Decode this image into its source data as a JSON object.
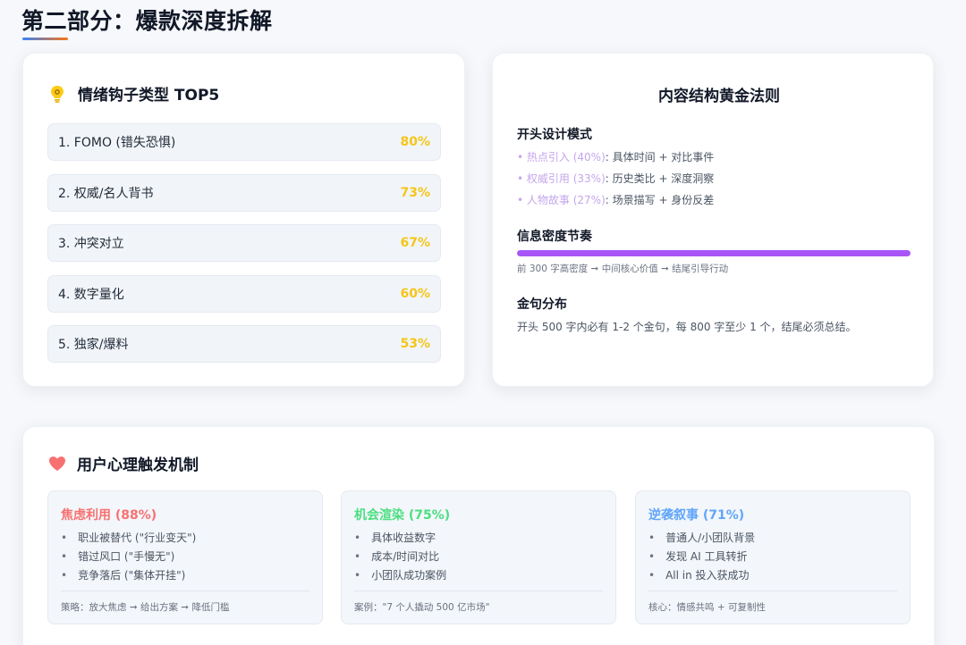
{
  "header": {
    "title": "第二部分：爆款深度拆解"
  },
  "hooks": {
    "title": "情绪钩子类型 TOP5",
    "accent": "#f5c518",
    "items": [
      {
        "label": "1. FOMO (错失恐惧)",
        "pct": "80%"
      },
      {
        "label": "2. 权威/名人背书",
        "pct": "73%"
      },
      {
        "label": "3. 冲突对立",
        "pct": "67%"
      },
      {
        "label": "4. 数字量化",
        "pct": "60%"
      },
      {
        "label": "5. 独家/爆料",
        "pct": "53%"
      }
    ]
  },
  "rules": {
    "title": "内容结构黄金法则",
    "opening": {
      "title": "开头设计模式",
      "items": [
        {
          "bullet": "•",
          "key": "热点引入 (40%)",
          "desc": ": 具体时间 + 对比事件"
        },
        {
          "bullet": "•",
          "key": "权威引用 (33%)",
          "desc": ": 历史类比 + 深度洞察"
        },
        {
          "bullet": "•",
          "key": "人物故事 (27%)",
          "desc": ": 场景描写 + 身份反差"
        }
      ]
    },
    "density": {
      "title": "信息密度节奏",
      "fill_fraction": 1.0,
      "note": "前 300 字高密度 ➞ 中间核心价值 ➞ 结尾引导行动"
    },
    "quotes": {
      "title": "金句分布",
      "text": "开头 500 字内必有 1-2 个金句，每 800 字至少 1 个，结尾必须总结。"
    }
  },
  "psych": {
    "title": "用户心理触发机制",
    "boxes": [
      {
        "title": "焦虑利用 (88%)",
        "color": "#f87171",
        "items": [
          "职业被替代 (\"行业变天\")",
          "错过风口 (\"手慢无\")",
          "竞争落后 (\"集体开挂\")"
        ],
        "foot": "策略：放大焦虑 ➞ 给出方案 ➞ 降低门槛"
      },
      {
        "title": "机会渲染 (75%)",
        "color": "#4ade80",
        "items": [
          "具体收益数字",
          "成本/时间对比",
          "小团队成功案例"
        ],
        "foot": "案例：\"7 个人撬动 500 亿市场\""
      },
      {
        "title": "逆袭叙事 (71%)",
        "color": "#60a5fa",
        "items": [
          "普通人/小团队背景",
          "发现 AI 工具转折",
          "All in 投入获成功"
        ],
        "foot": "核心：情感共鸣 + 可复制性"
      }
    ]
  }
}
